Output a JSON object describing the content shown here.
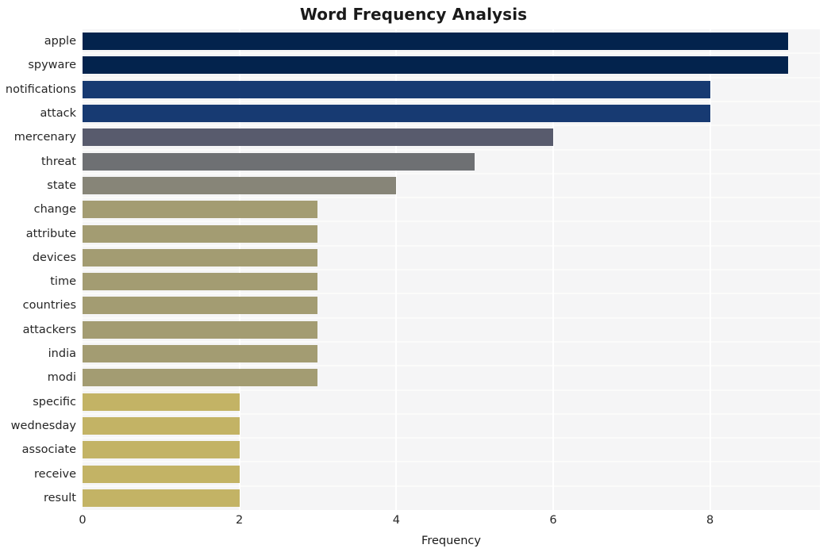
{
  "chart_data": {
    "type": "bar",
    "orientation": "horizontal",
    "title": "Word Frequency Analysis",
    "xlabel": "Frequency",
    "ylabel": "",
    "xlim": [
      0,
      9.4
    ],
    "ylim": [
      0,
      20
    ],
    "grid": true,
    "legend": null,
    "xticks": [
      "0",
      "2",
      "4",
      "6",
      "8"
    ],
    "xtick_values": [
      0,
      2,
      4,
      6,
      8
    ],
    "categories": [
      "apple",
      "spyware",
      "notifications",
      "attack",
      "mercenary",
      "threat",
      "state",
      "change",
      "attribute",
      "devices",
      "time",
      "countries",
      "attackers",
      "india",
      "modi",
      "specific",
      "wednesday",
      "associate",
      "receive",
      "result"
    ],
    "values": [
      9,
      9,
      8,
      8,
      6,
      5,
      4,
      3,
      3,
      3,
      3,
      3,
      3,
      3,
      3,
      2,
      2,
      2,
      2,
      2
    ],
    "bar_colors": [
      "#03234d",
      "#03234d",
      "#173a72",
      "#173a72",
      "#585b6d",
      "#6e7073",
      "#878578",
      "#a39c72",
      "#a39c72",
      "#a39c72",
      "#a39c72",
      "#a39c72",
      "#a39c72",
      "#a39c72",
      "#a39c72",
      "#c3b365",
      "#c3b365",
      "#c3b365",
      "#c3b365",
      "#c3b365"
    ],
    "plot_background": "#f5f5f6",
    "grid_color": "#ffffff",
    "figure_background": "#ffffff"
  }
}
